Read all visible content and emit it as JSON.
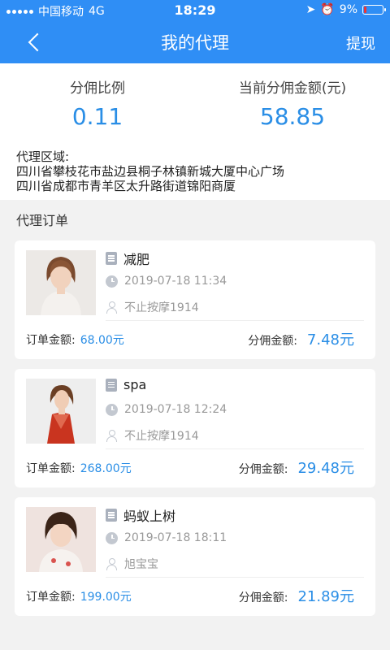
{
  "status_bar": {
    "carrier": "中国移动",
    "network": "4G",
    "time": "18:29",
    "battery": "9%"
  },
  "nav": {
    "title": "我的代理",
    "right_action": "提现"
  },
  "stats": {
    "ratio_label": "分佣比例",
    "ratio_value": "0.11",
    "amount_label": "当前分佣金额(元)",
    "amount_value": "58.85"
  },
  "region": {
    "label": "代理区域:",
    "lines": [
      "四川省攀枝花市盐边县桐子林镇新城大厦中心广场",
      "四川省成都市青羊区太升路街道锦阳商厦"
    ]
  },
  "orders_title": "代理订单",
  "orders": [
    {
      "name": "减肥",
      "time": "2019-07-18 11:34",
      "shop": "不止按摩1914",
      "order_label": "订单金额:",
      "order_amount": "68.00元",
      "commission_label": "分佣金额:",
      "commission": "7.48元"
    },
    {
      "name": "spa",
      "time": "2019-07-18 12:24",
      "shop": "不止按摩1914",
      "order_label": "订单金额:",
      "order_amount": "268.00元",
      "commission_label": "分佣金额:",
      "commission": "29.48元"
    },
    {
      "name": "蚂蚁上树",
      "time": "2019-07-18 18:11",
      "shop": "旭宝宝",
      "order_label": "订单金额:",
      "order_amount": "199.00元",
      "commission_label": "分佣金额:",
      "commission": "21.89元"
    }
  ],
  "colors": {
    "header": "#2f8ef5",
    "accent": "#2a8ee6",
    "background": "#f2f2f2"
  },
  "icons": [
    "back-arrow-icon",
    "document-icon",
    "clock-icon",
    "user-icon",
    "battery-icon",
    "signal-icon"
  ]
}
